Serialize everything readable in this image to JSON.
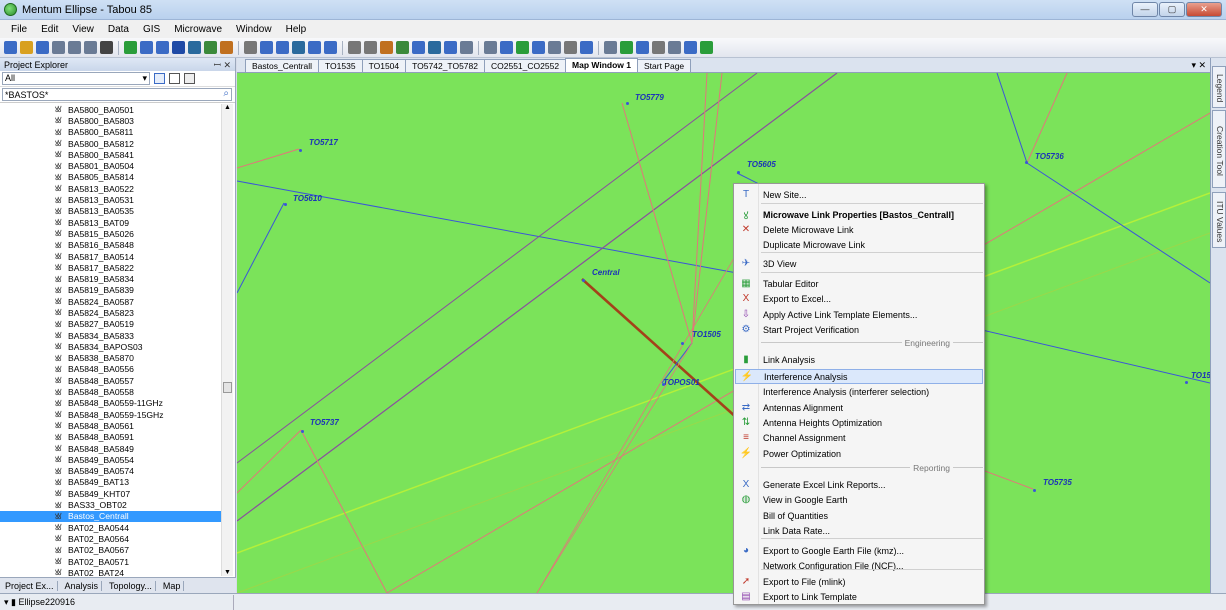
{
  "window": {
    "title": "Mentum Ellipse - Tabou 85",
    "minimize": "—",
    "maximize": "▢",
    "close": "✕"
  },
  "menu": [
    "File",
    "Edit",
    "View",
    "Data",
    "GIS",
    "Microwave",
    "Window",
    "Help"
  ],
  "project_explorer": {
    "title": "Project Explorer",
    "pin": "ꟷ ✕",
    "filter": "All",
    "search": "*BASTOS*",
    "items": [
      "BA5800_BA0501",
      "BA5800_BA5803",
      "BA5800_BA5811",
      "BA5800_BA5812",
      "BA5800_BA5841",
      "BA5801_BA0504",
      "BA5805_BA5814",
      "BA5813_BA0522",
      "BA5813_BA0531",
      "BA5813_BA0535",
      "BA5813_BAT09",
      "BA5815_BA5026",
      "BA5816_BA5848",
      "BA5817_BA0514",
      "BA5817_BA5822",
      "BA5819_BA5834",
      "BA5819_BA5839",
      "BA5824_BA0587",
      "BA5824_BA5823",
      "BA5827_BA0519",
      "BA5834_BA5833",
      "BA5834_BAPOS03",
      "BA5838_BA5870",
      "BA5848_BA0556",
      "BA5848_BA0557",
      "BA5848_BA0558",
      "BA5848_BA0559-11GHz",
      "BA5848_BA0559-15GHz",
      "BA5848_BA0561",
      "BA5848_BA0591",
      "BA5848_BA5849",
      "BA5849_BA0554",
      "BA5849_BA0574",
      "BA5849_BAT13",
      "BA5849_KHT07",
      "BAS33_OBT02",
      "Bastos_Centrall",
      "BAT02_BA0544",
      "BAT02_BA0564",
      "BAT02_BA0567",
      "BAT02_BA0571",
      "BAT02_BAT24"
    ],
    "selected_index": 36,
    "tabs": [
      "Project Ex...",
      "Analysis",
      "Topology...",
      "Map"
    ]
  },
  "doc_tabs": [
    "Bastos_Centrall",
    "TO1535",
    "TO1504",
    "TO5742_TO5782",
    "CO2551_CO2552",
    "Map Window 1",
    "Start Page"
  ],
  "active_tab": "Map Window 1",
  "doc_tab_controls": "▾ ✕",
  "right_tabs": [
    "Legend",
    "Creation Tool",
    "ITU Values"
  ],
  "map_sites": [
    "TO5779",
    "TO5717",
    "TO5605",
    "TO5736",
    "TO5610",
    "Central",
    "TO1505",
    "TOPOS01",
    "TO15",
    "TO5737",
    "TO5735"
  ],
  "context_menu": {
    "items": [
      {
        "label": "New Site...",
        "icon": "new-site-icon",
        "glyph": "T"
      },
      {
        "label": "Microwave Link Properties [Bastos_Centrall]",
        "icon": "link-properties-icon",
        "glyph": "ꙋ",
        "bold": true
      },
      {
        "label": "Delete Microwave Link",
        "icon": "delete-icon",
        "glyph": "✕"
      },
      {
        "label": "Duplicate Microwave Link",
        "icon": "",
        "glyph": ""
      },
      {
        "label": "3D View",
        "icon": "3d-view-icon",
        "glyph": "✈"
      },
      {
        "label": "Tabular Editor",
        "icon": "tabular-editor-icon",
        "glyph": "▦"
      },
      {
        "label": "Export to Excel...",
        "icon": "excel-icon",
        "glyph": "X"
      },
      {
        "label": "Apply Active Link Template Elements...",
        "icon": "template-icon",
        "glyph": "⇩"
      },
      {
        "label": "Start Project Verification",
        "icon": "verification-icon",
        "glyph": "⚙"
      },
      {
        "label": "Link Analysis",
        "icon": "link-analysis-icon",
        "glyph": "▮"
      },
      {
        "label": "Interference Analysis",
        "icon": "interference-icon",
        "glyph": "⚡"
      },
      {
        "label": "Interference Analysis (interferer selection)",
        "icon": "",
        "glyph": ""
      },
      {
        "label": "Antennas Alignment",
        "icon": "antenna-alignment-icon",
        "glyph": "⇄"
      },
      {
        "label": "Antenna Heights Optimization",
        "icon": "antenna-heights-icon",
        "glyph": "⇅"
      },
      {
        "label": "Channel Assignment",
        "icon": "channel-icon",
        "glyph": "≡"
      },
      {
        "label": "Power Optimization",
        "icon": "power-icon",
        "glyph": "⚡"
      },
      {
        "label": "Generate Excel Link Reports...",
        "icon": "excel-report-icon",
        "glyph": "X"
      },
      {
        "label": "View in Google Earth",
        "icon": "google-earth-icon",
        "glyph": "◍"
      },
      {
        "label": "Bill of Quantities",
        "icon": "",
        "glyph": ""
      },
      {
        "label": "Link Data Rate...",
        "icon": "",
        "glyph": ""
      },
      {
        "label": "Export to Google Earth File (kmz)...",
        "icon": "kmz-icon",
        "glyph": "◕"
      },
      {
        "label": "Network Configuration File (NCF)...",
        "icon": "",
        "glyph": ""
      },
      {
        "label": "Export to File (mlink)",
        "icon": "export-file-icon",
        "glyph": "➚"
      },
      {
        "label": "Export to Link Template",
        "icon": "link-template-icon",
        "glyph": "▤"
      }
    ],
    "groups": [
      "Engineering",
      "Reporting"
    ],
    "highlighted_index": 10
  },
  "status": {
    "scenario": "Ellipse220916"
  },
  "colors": {
    "map_bg": "#7be35a",
    "link_blue": "#3b55d9",
    "link_red": "#e0787a",
    "link_purple": "#8a4f9e",
    "link_selected": "#a3421a",
    "site_label": "#1c33b8"
  }
}
